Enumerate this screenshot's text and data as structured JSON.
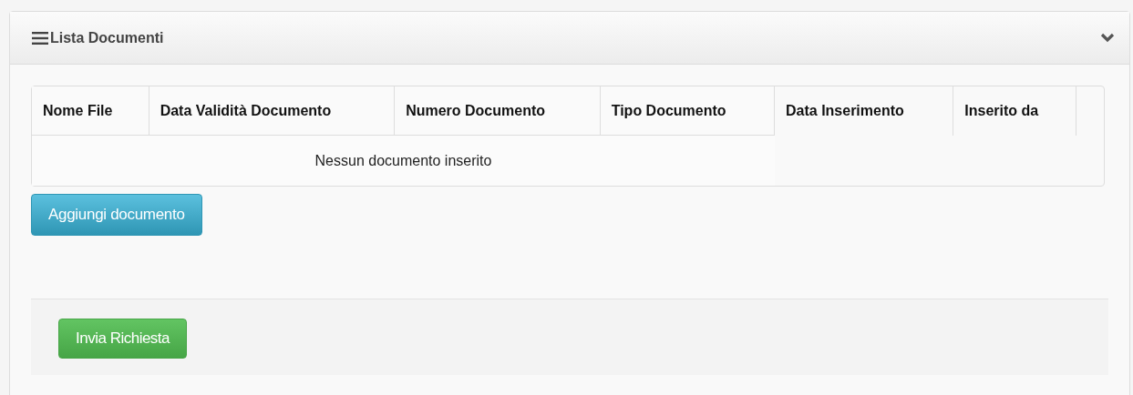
{
  "panel": {
    "title": "Lista Documenti"
  },
  "table": {
    "columns": [
      "Nome File",
      "Data Validità Documento",
      "Numero Documento",
      "Tipo Documento",
      "Data Inserimento",
      "Inserito da"
    ],
    "empty_message": "Nessun documento inserito"
  },
  "add_button": "Aggiungi documento",
  "submit_button": "Invia Richiesta"
}
